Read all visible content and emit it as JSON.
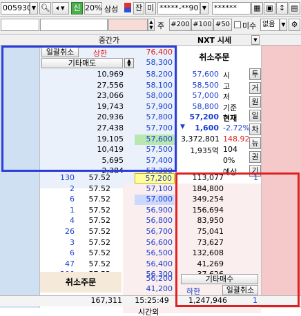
{
  "toolbar": {
    "code": "005930",
    "search_icon": "search-icon",
    "sound_icon": "speaker-icon",
    "sin_label": "신",
    "pct_label": "20%",
    "name": "삼성",
    "jan_label": "잔",
    "mi_label": "미",
    "account": "*****-**90",
    "password": "******",
    "qty_label": "주",
    "q200": "#200",
    "q100": "#100",
    "q50": "#50",
    "misu_label": "미수",
    "none_label": "없음"
  },
  "header": {
    "center_col": "중간가",
    "nxt_label": "NXT 시세"
  },
  "ask_top": {
    "bulk_cancel": "일괄취소",
    "upper_limit_label": "상한",
    "upper_limit_price": "76,400",
    "other_sell": "기타매도",
    "other_sell_price": "58,300",
    "cancel_order": "취소주문"
  },
  "asks": [
    {
      "qty": "10,969",
      "price": "58,200"
    },
    {
      "qty": "27,556",
      "price": "58,100"
    },
    {
      "qty": "23,066",
      "price": "58,000"
    },
    {
      "qty": "19,743",
      "price": "57,900"
    },
    {
      "qty": "20,936",
      "price": "57,800"
    },
    {
      "qty": "27,438",
      "price": "57,700"
    },
    {
      "qty": "19,105",
      "price": "57,600"
    },
    {
      "qty": "10,419",
      "price": "57,500"
    },
    {
      "qty": "5,695",
      "price": "57,400"
    },
    {
      "qty": "2,384",
      "price": "57,300"
    }
  ],
  "nxt_info": [
    {
      "value": "57,600",
      "label": "시"
    },
    {
      "value": "58,500",
      "label": "고"
    },
    {
      "value": "57,000",
      "label": "저"
    },
    {
      "value": "58,800",
      "label": "기준"
    },
    {
      "value": "57,200",
      "label": "현재"
    },
    {
      "value": "1,600",
      "label": "-2.72%"
    },
    {
      "value": "3,372,801",
      "label": "148.92"
    },
    {
      "value": "1,935억",
      "label": "104"
    },
    {
      "value": "",
      "label": "0%"
    },
    {
      "value": "",
      "label": "예상"
    }
  ],
  "side_tabs": [
    "투",
    "거",
    "원",
    "일",
    "차",
    "뉴",
    "권",
    "기"
  ],
  "fills": [
    {
      "left": "130",
      "mid": "57.52",
      "price": "57,200",
      "right": "113,077",
      "rr": "1"
    },
    {
      "left": "2",
      "mid": "57.52",
      "price": "57,100",
      "right": "184,800",
      "rr": ""
    },
    {
      "left": "6",
      "mid": "57.52",
      "price": "57,000",
      "right": "349,254",
      "rr": ""
    },
    {
      "left": "1",
      "mid": "57.52",
      "price": "56,900",
      "right": "156,694",
      "rr": ""
    },
    {
      "left": "4",
      "mid": "57.52",
      "price": "56,800",
      "right": "83,950",
      "rr": ""
    },
    {
      "left": "26",
      "mid": "57.52",
      "price": "56,700",
      "right": "75,041",
      "rr": ""
    },
    {
      "left": "3",
      "mid": "57.52",
      "price": "56,600",
      "right": "73,627",
      "rr": ""
    },
    {
      "left": "6",
      "mid": "57.52",
      "price": "56,500",
      "right": "132,608",
      "rr": ""
    },
    {
      "left": "47",
      "mid": "57.52",
      "price": "56,400",
      "right": "41,269",
      "rr": ""
    },
    {
      "left": "200",
      "mid": "57.52",
      "price": "56,300",
      "right": "37,626",
      "rr": ""
    }
  ],
  "bid_bottom": {
    "cancel_order": "취소주문",
    "price_a": "56,200",
    "other_buy": "기타매수",
    "price_b": "41,200",
    "lower_limit_label": "하한",
    "bulk_cancel": "일괄취소"
  },
  "footer": {
    "total_ask": "167,311",
    "time": "15:25:49",
    "total_bid": "1,247,946",
    "count": "1",
    "after_hours": "시간외"
  }
}
